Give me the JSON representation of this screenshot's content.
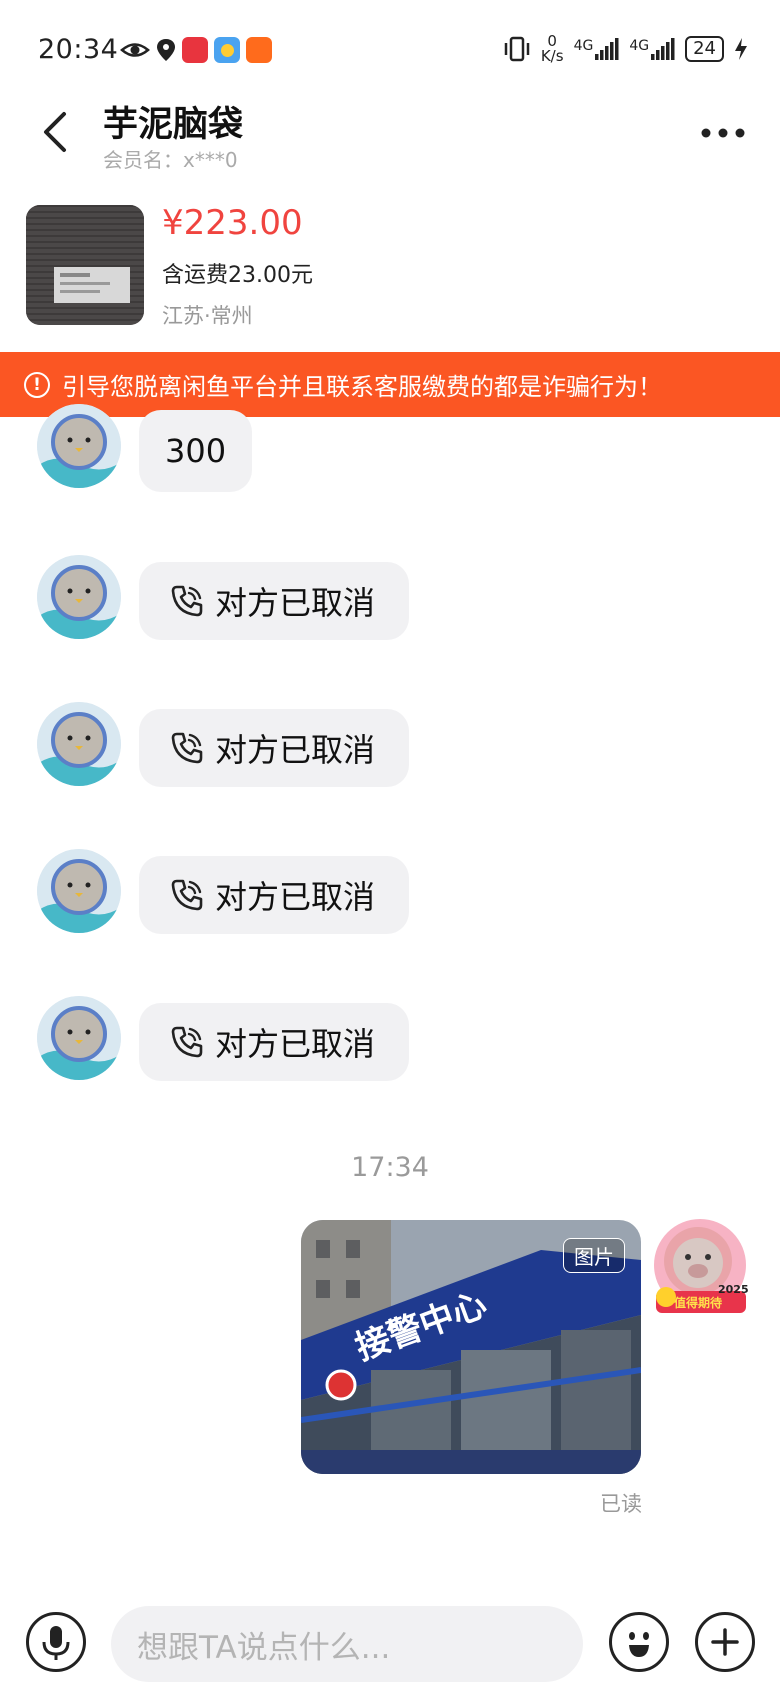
{
  "status_bar": {
    "time": "20:34",
    "network_speed_top": "0",
    "network_speed_unit": "K/s",
    "signal_1": "4G",
    "signal_2": "4G",
    "battery": "24",
    "icons": [
      "eye-icon",
      "location-icon",
      "app-notification-icon",
      "weather-icon",
      "wallet-icon",
      "vibrate-icon",
      "charging-icon"
    ]
  },
  "header": {
    "title": "芋泥脑袋",
    "subtitle": "会员名：x***0"
  },
  "product": {
    "price": "¥223.00",
    "shipping": "含运费23.00元",
    "location": "江苏·常州"
  },
  "warning": {
    "text": "引导您脱离闲鱼平台并且联系客服缴费的都是诈骗行为！",
    "icon_text": "!",
    "color": "#fb5623"
  },
  "messages": [
    {
      "type": "text",
      "text": "300"
    },
    {
      "type": "call",
      "text": "对方已取消"
    },
    {
      "type": "call",
      "text": "对方已取消"
    },
    {
      "type": "call",
      "text": "对方已取消"
    },
    {
      "type": "call",
      "text": "对方已取消"
    }
  ],
  "time_separator": "17:34",
  "image_message": {
    "tag": "图片",
    "sign_text": "接警中心",
    "avatar_badge": "2025",
    "status": "已读"
  },
  "input": {
    "placeholder": "想跟TA说点什么..."
  },
  "colors": {
    "price": "#f0443f",
    "bubble": "#f1f1f3",
    "accent_banner": "#fb5623"
  }
}
